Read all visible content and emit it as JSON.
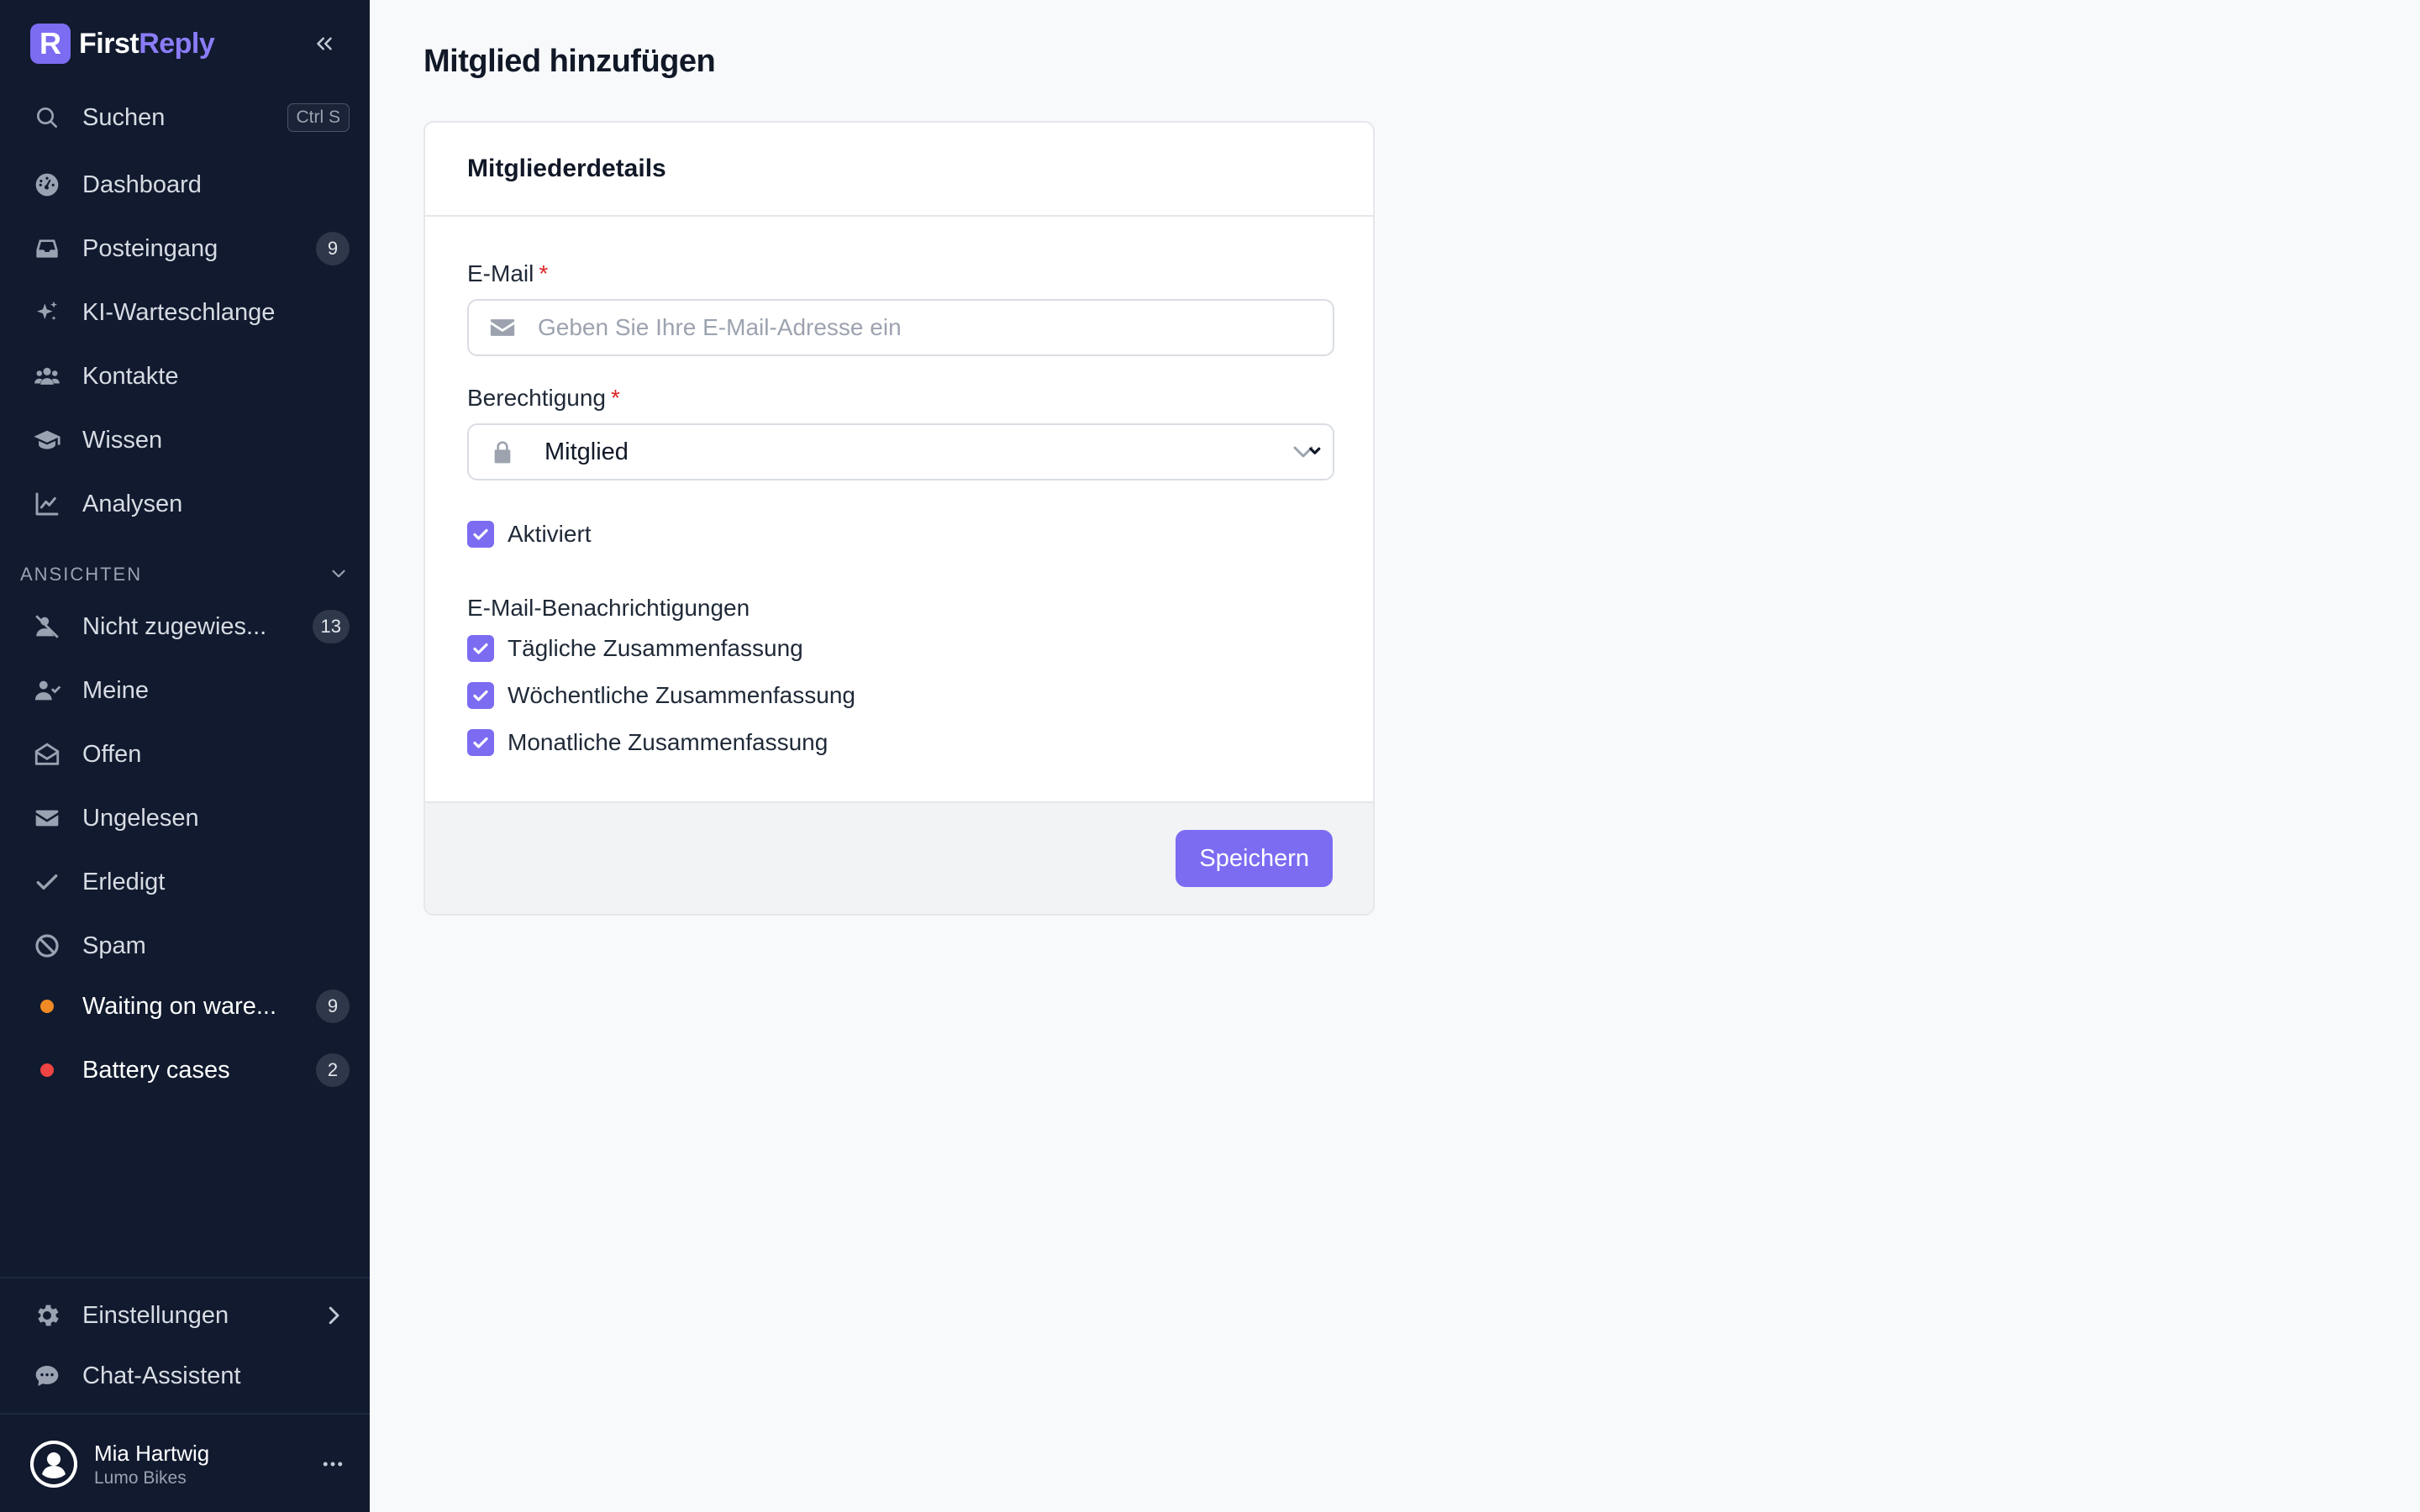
{
  "app": {
    "brand_prefix": "First",
    "brand_suffix": "Reply",
    "brand_mark": "R",
    "accent_color": "#7c6cf2"
  },
  "sidebar": {
    "search": {
      "label": "Suchen",
      "shortcut": "Ctrl S"
    },
    "items": [
      {
        "label": "Dashboard",
        "icon": "dashboard-gauge-icon"
      },
      {
        "label": "Posteingang",
        "icon": "inbox-tray-icon",
        "count": "9"
      },
      {
        "label": "KI-Warteschlange",
        "icon": "sparkles-icon"
      },
      {
        "label": "Kontakte",
        "icon": "users-icon"
      },
      {
        "label": "Wissen",
        "icon": "graduation-cap-icon"
      },
      {
        "label": "Analysen",
        "icon": "line-chart-icon"
      }
    ],
    "section_title": "ANSICHTEN",
    "views": [
      {
        "label": "Nicht zugewies...",
        "icon": "user-slash-icon",
        "count": "13"
      },
      {
        "label": "Meine",
        "icon": "user-check-icon"
      },
      {
        "label": "Offen",
        "icon": "envelope-open-icon"
      },
      {
        "label": "Ungelesen",
        "icon": "envelope-icon"
      },
      {
        "label": "Erledigt",
        "icon": "check-icon"
      },
      {
        "label": "Spam",
        "icon": "ban-icon"
      },
      {
        "label": "Waiting on ware...",
        "dot_color": "#f08a24",
        "count": "9"
      },
      {
        "label": "Battery cases",
        "dot_color": "#ef4444",
        "count": "2"
      }
    ],
    "settings_label": "Einstellungen",
    "chat_label": "Chat-Assistent",
    "user": {
      "name": "Mia Hartwig",
      "org": "Lumo Bikes"
    }
  },
  "main": {
    "title": "Mitglied hinzufügen",
    "card_title": "Mitgliederdetails",
    "email": {
      "label": "E-Mail",
      "required": "*",
      "placeholder": "Geben Sie Ihre E-Mail-Adresse ein"
    },
    "permission": {
      "label": "Berechtigung",
      "required": "*",
      "value": "Mitglied"
    },
    "activated_label": "Aktiviert",
    "notifications_title": "E-Mail-Benachrichtigungen",
    "notifications": [
      {
        "label": "Tägliche Zusammenfassung",
        "checked": true
      },
      {
        "label": "Wöchentliche Zusammenfassung",
        "checked": true
      },
      {
        "label": "Monatliche Zusammenfassung",
        "checked": true
      }
    ],
    "save_label": "Speichern"
  }
}
